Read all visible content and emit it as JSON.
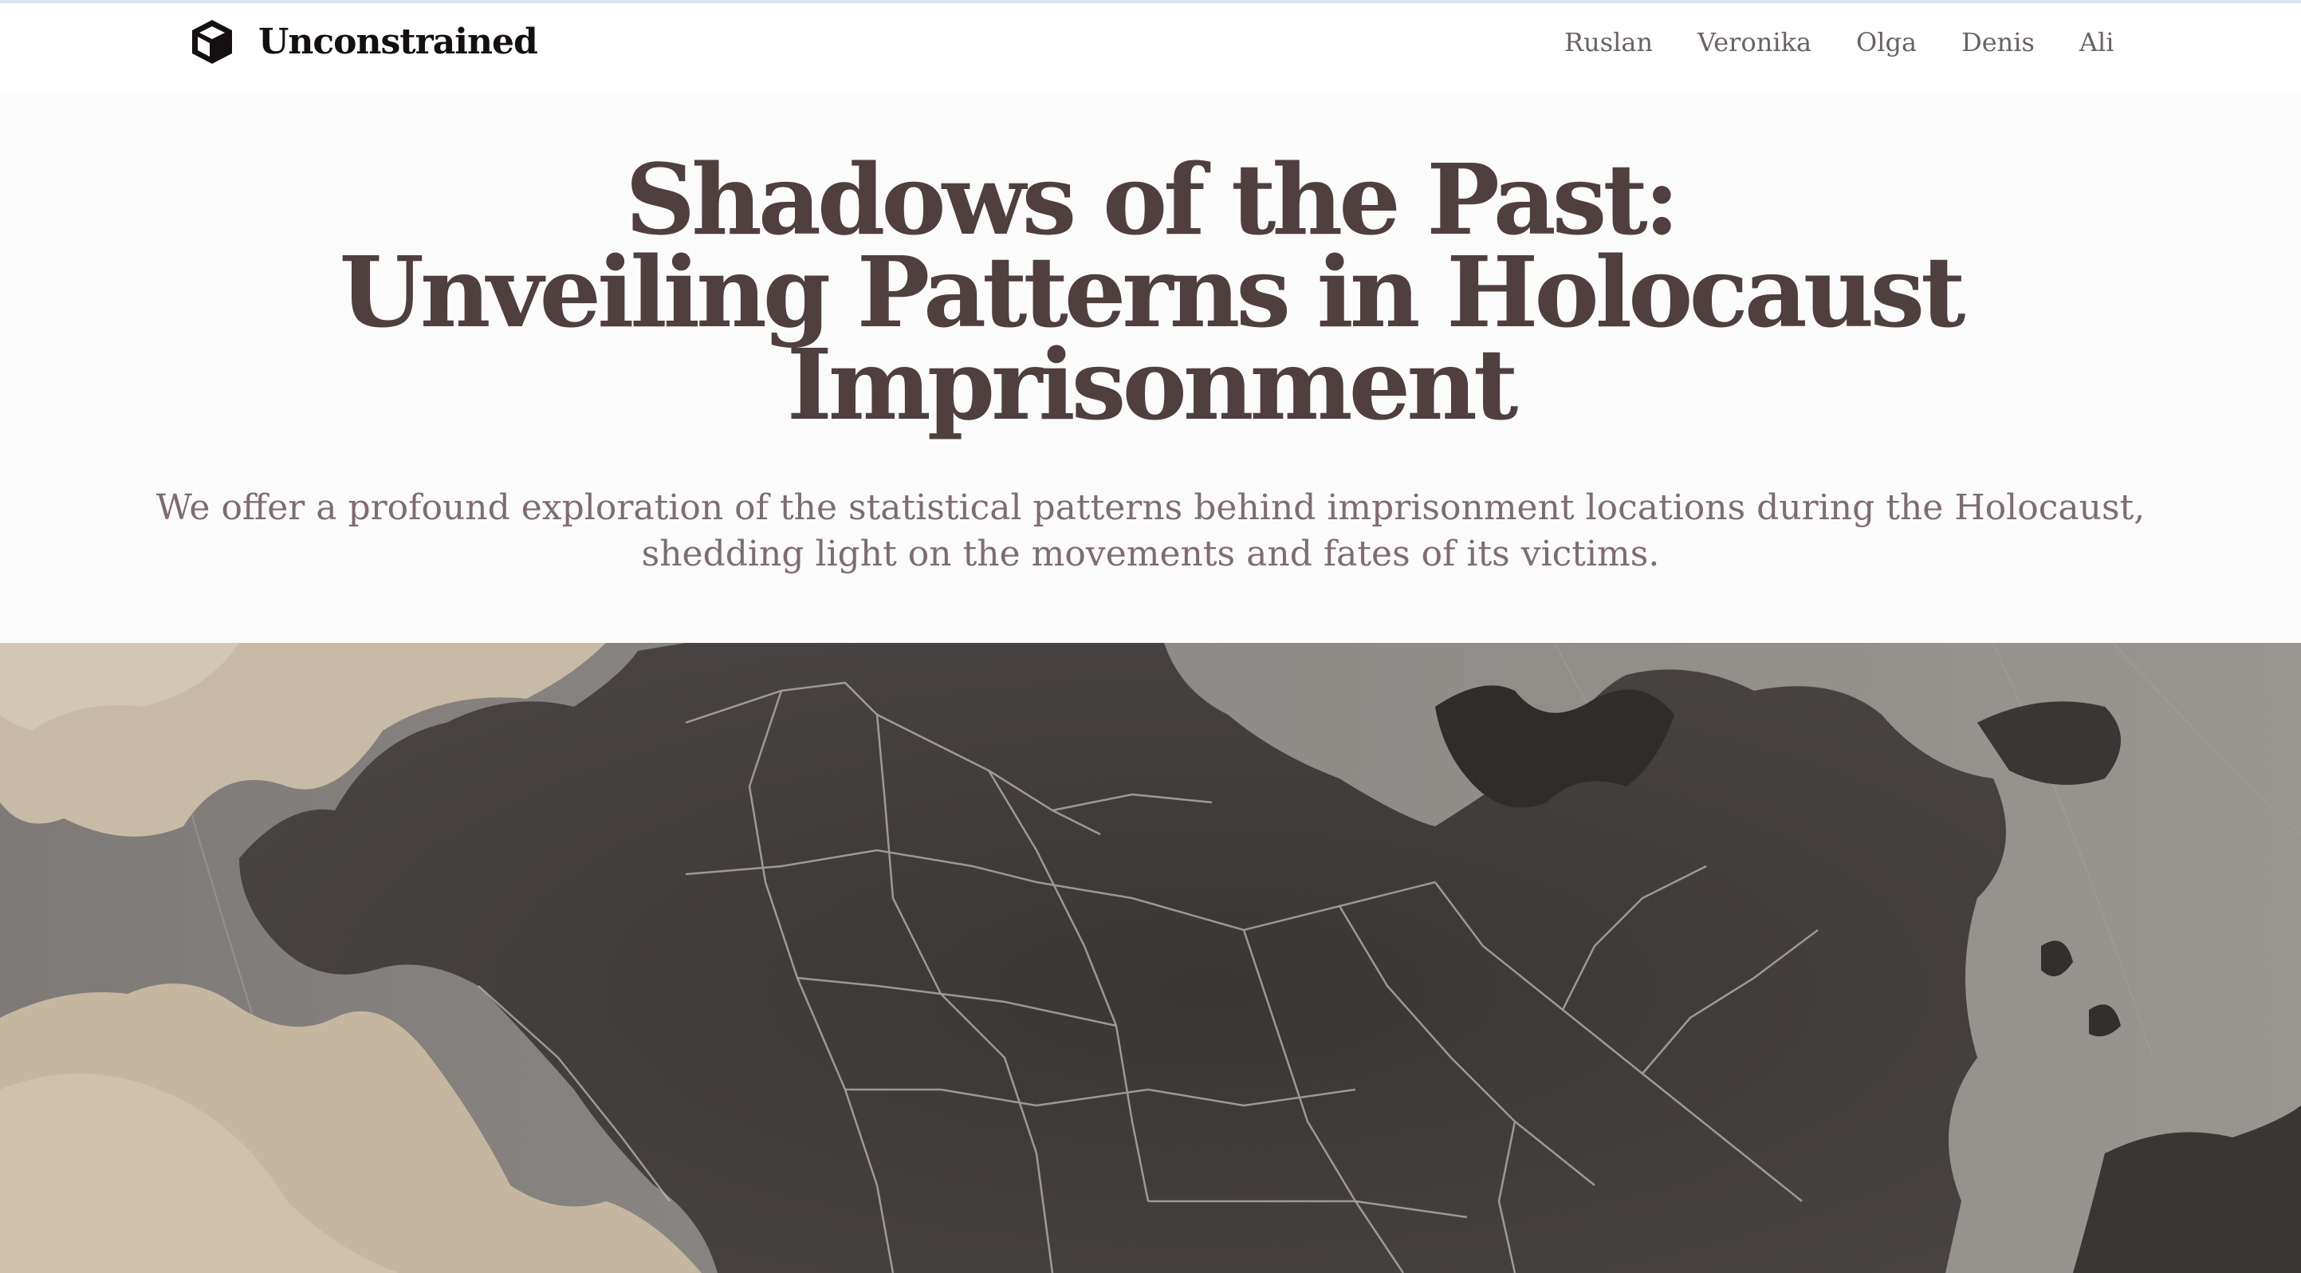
{
  "brand": {
    "name": "Unconstrained",
    "icon": "cube-icon"
  },
  "nav": {
    "links": [
      "Ruslan",
      "Veronika",
      "Olga",
      "Denis",
      "Ali"
    ]
  },
  "hero": {
    "title_lines": [
      "Shadows of the Past:",
      "Unveiling Patterns in Holocaust",
      "Imprisonment"
    ],
    "subtitle": "We offer a profound exploration of the statistical patterns behind imprisonment locations during the Holocaust, shedding light on the movements and fates of its victims.",
    "image": "vintage-europe-map-image"
  },
  "colors": {
    "title": "#4f3f3f",
    "subtitle": "#7e6c70",
    "nav_text": "#6a6267",
    "brand_text": "#141010",
    "page_background": "#fcfbfb",
    "map_land": "#3c3838",
    "map_water": "#8e8b88",
    "map_parchment": "#c8bca6"
  }
}
